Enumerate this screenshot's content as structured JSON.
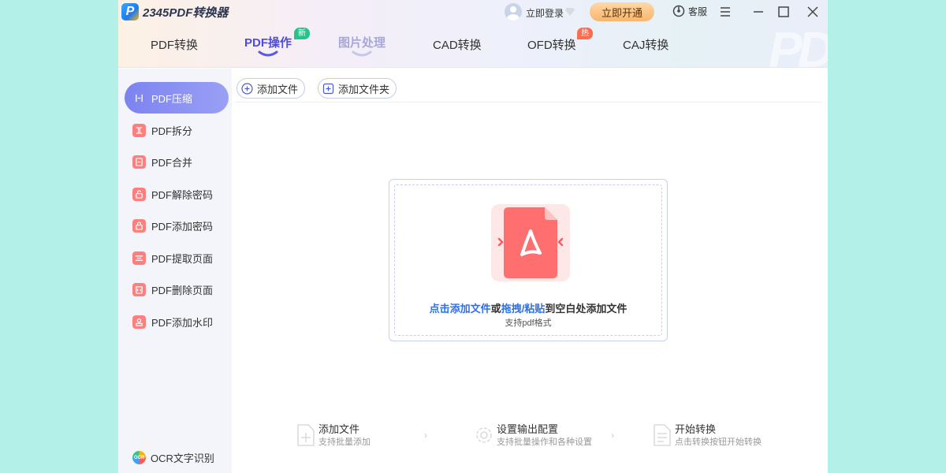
{
  "app": {
    "logo_mark": "P",
    "logo_text": "2345PDF转换器",
    "login_text": "立即登录",
    "vip_button": "立即开通",
    "service_label": "客服"
  },
  "tabs": [
    {
      "label": "PDF转换"
    },
    {
      "label": "PDF操作",
      "badge": "新",
      "active": true
    },
    {
      "label": "图片处理"
    },
    {
      "label": "CAD转换"
    },
    {
      "label": "OFD转换",
      "badge": "热"
    },
    {
      "label": "CAJ转换"
    }
  ],
  "sidebar": {
    "items": [
      {
        "label": "PDF压缩",
        "icon": "compress-icon",
        "active": true
      },
      {
        "label": "PDF拆分",
        "icon": "split-icon"
      },
      {
        "label": "PDF合并",
        "icon": "merge-icon"
      },
      {
        "label": "PDF解除密码",
        "icon": "unlock-icon"
      },
      {
        "label": "PDF添加密码",
        "icon": "lock-icon"
      },
      {
        "label": "PDF提取页面",
        "icon": "extract-icon"
      },
      {
        "label": "PDF删除页面",
        "icon": "delete-icon"
      },
      {
        "label": "PDF添加水印",
        "icon": "watermark-icon"
      }
    ],
    "ocr_label": "OCR文字识别",
    "ocr_icon_text": "OCR"
  },
  "toolbar": {
    "add_file": "添加文件",
    "add_folder": "添加文件夹"
  },
  "dropzone": {
    "hint_link1": "点击添加文件",
    "hint_or": "或",
    "hint_link2": "拖拽/粘贴",
    "hint_rest": "到空白处添加文件",
    "sub": "支持pdf格式"
  },
  "steps": [
    {
      "title": "添加文件",
      "desc": "支持批量添加"
    },
    {
      "title": "设置输出配置",
      "desc": "支持批量操作和各种设置"
    },
    {
      "title": "开始转换",
      "desc": "点击转换按钮开始转换"
    }
  ],
  "colors": {
    "accent": "#4d4dd8",
    "link": "#2f6fe8",
    "vip": "#f7b66c",
    "pdf_red": "#ff6b6b",
    "badge_new": "#27c48a",
    "badge_hot": "#ff6b4d"
  }
}
